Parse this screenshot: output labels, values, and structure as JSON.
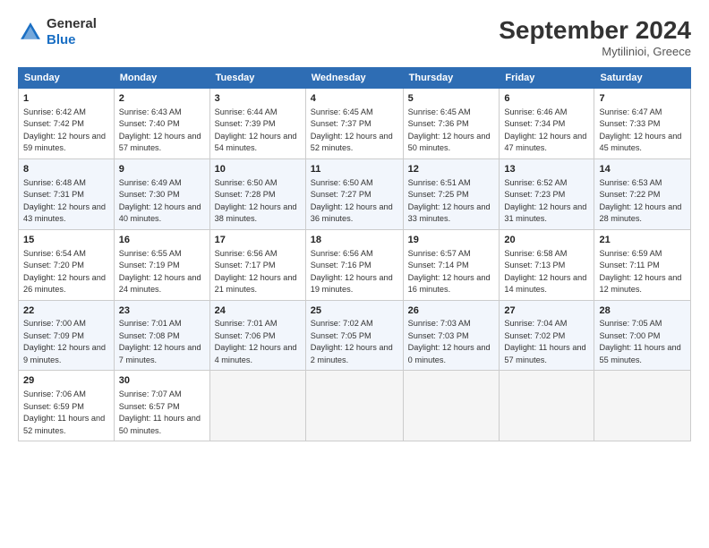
{
  "header": {
    "logo_line1": "General",
    "logo_line2": "Blue",
    "month": "September 2024",
    "location": "Mytilinioi, Greece"
  },
  "days_of_week": [
    "Sunday",
    "Monday",
    "Tuesday",
    "Wednesday",
    "Thursday",
    "Friday",
    "Saturday"
  ],
  "weeks": [
    [
      {
        "day": "1",
        "sunrise": "6:42 AM",
        "sunset": "7:42 PM",
        "daylight": "12 hours and 59 minutes."
      },
      {
        "day": "2",
        "sunrise": "6:43 AM",
        "sunset": "7:40 PM",
        "daylight": "12 hours and 57 minutes."
      },
      {
        "day": "3",
        "sunrise": "6:44 AM",
        "sunset": "7:39 PM",
        "daylight": "12 hours and 54 minutes."
      },
      {
        "day": "4",
        "sunrise": "6:45 AM",
        "sunset": "7:37 PM",
        "daylight": "12 hours and 52 minutes."
      },
      {
        "day": "5",
        "sunrise": "6:45 AM",
        "sunset": "7:36 PM",
        "daylight": "12 hours and 50 minutes."
      },
      {
        "day": "6",
        "sunrise": "6:46 AM",
        "sunset": "7:34 PM",
        "daylight": "12 hours and 47 minutes."
      },
      {
        "day": "7",
        "sunrise": "6:47 AM",
        "sunset": "7:33 PM",
        "daylight": "12 hours and 45 minutes."
      }
    ],
    [
      {
        "day": "8",
        "sunrise": "6:48 AM",
        "sunset": "7:31 PM",
        "daylight": "12 hours and 43 minutes."
      },
      {
        "day": "9",
        "sunrise": "6:49 AM",
        "sunset": "7:30 PM",
        "daylight": "12 hours and 40 minutes."
      },
      {
        "day": "10",
        "sunrise": "6:50 AM",
        "sunset": "7:28 PM",
        "daylight": "12 hours and 38 minutes."
      },
      {
        "day": "11",
        "sunrise": "6:50 AM",
        "sunset": "7:27 PM",
        "daylight": "12 hours and 36 minutes."
      },
      {
        "day": "12",
        "sunrise": "6:51 AM",
        "sunset": "7:25 PM",
        "daylight": "12 hours and 33 minutes."
      },
      {
        "day": "13",
        "sunrise": "6:52 AM",
        "sunset": "7:23 PM",
        "daylight": "12 hours and 31 minutes."
      },
      {
        "day": "14",
        "sunrise": "6:53 AM",
        "sunset": "7:22 PM",
        "daylight": "12 hours and 28 minutes."
      }
    ],
    [
      {
        "day": "15",
        "sunrise": "6:54 AM",
        "sunset": "7:20 PM",
        "daylight": "12 hours and 26 minutes."
      },
      {
        "day": "16",
        "sunrise": "6:55 AM",
        "sunset": "7:19 PM",
        "daylight": "12 hours and 24 minutes."
      },
      {
        "day": "17",
        "sunrise": "6:56 AM",
        "sunset": "7:17 PM",
        "daylight": "12 hours and 21 minutes."
      },
      {
        "day": "18",
        "sunrise": "6:56 AM",
        "sunset": "7:16 PM",
        "daylight": "12 hours and 19 minutes."
      },
      {
        "day": "19",
        "sunrise": "6:57 AM",
        "sunset": "7:14 PM",
        "daylight": "12 hours and 16 minutes."
      },
      {
        "day": "20",
        "sunrise": "6:58 AM",
        "sunset": "7:13 PM",
        "daylight": "12 hours and 14 minutes."
      },
      {
        "day": "21",
        "sunrise": "6:59 AM",
        "sunset": "7:11 PM",
        "daylight": "12 hours and 12 minutes."
      }
    ],
    [
      {
        "day": "22",
        "sunrise": "7:00 AM",
        "sunset": "7:09 PM",
        "daylight": "12 hours and 9 minutes."
      },
      {
        "day": "23",
        "sunrise": "7:01 AM",
        "sunset": "7:08 PM",
        "daylight": "12 hours and 7 minutes."
      },
      {
        "day": "24",
        "sunrise": "7:01 AM",
        "sunset": "7:06 PM",
        "daylight": "12 hours and 4 minutes."
      },
      {
        "day": "25",
        "sunrise": "7:02 AM",
        "sunset": "7:05 PM",
        "daylight": "12 hours and 2 minutes."
      },
      {
        "day": "26",
        "sunrise": "7:03 AM",
        "sunset": "7:03 PM",
        "daylight": "12 hours and 0 minutes."
      },
      {
        "day": "27",
        "sunrise": "7:04 AM",
        "sunset": "7:02 PM",
        "daylight": "11 hours and 57 minutes."
      },
      {
        "day": "28",
        "sunrise": "7:05 AM",
        "sunset": "7:00 PM",
        "daylight": "11 hours and 55 minutes."
      }
    ],
    [
      {
        "day": "29",
        "sunrise": "7:06 AM",
        "sunset": "6:59 PM",
        "daylight": "11 hours and 52 minutes."
      },
      {
        "day": "30",
        "sunrise": "7:07 AM",
        "sunset": "6:57 PM",
        "daylight": "11 hours and 50 minutes."
      },
      null,
      null,
      null,
      null,
      null
    ]
  ]
}
